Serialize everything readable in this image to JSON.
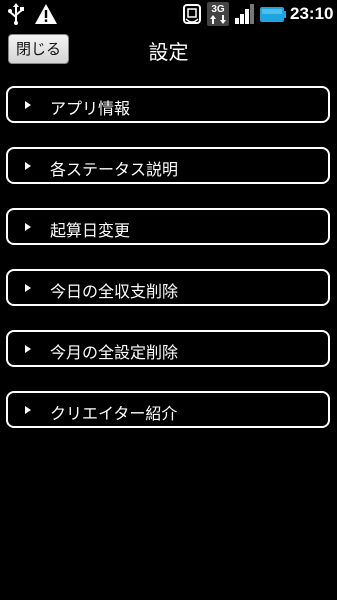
{
  "status_bar": {
    "icons": [
      "usb-icon",
      "warning-icon",
      "sim-icon",
      "network-3g-icon",
      "signal-icon",
      "battery-icon"
    ],
    "network_label": "3G",
    "time": "23:10",
    "battery_color": "#1ea4e0"
  },
  "header": {
    "back_label": "閉じる",
    "title": "設定"
  },
  "menu": {
    "items": [
      {
        "label": "アプリ情報"
      },
      {
        "label": "各ステータス説明"
      },
      {
        "label": "起算日変更"
      },
      {
        "label": "今日の全収支削除"
      },
      {
        "label": "今月の全設定削除"
      },
      {
        "label": "クリエイター紹介"
      }
    ]
  }
}
